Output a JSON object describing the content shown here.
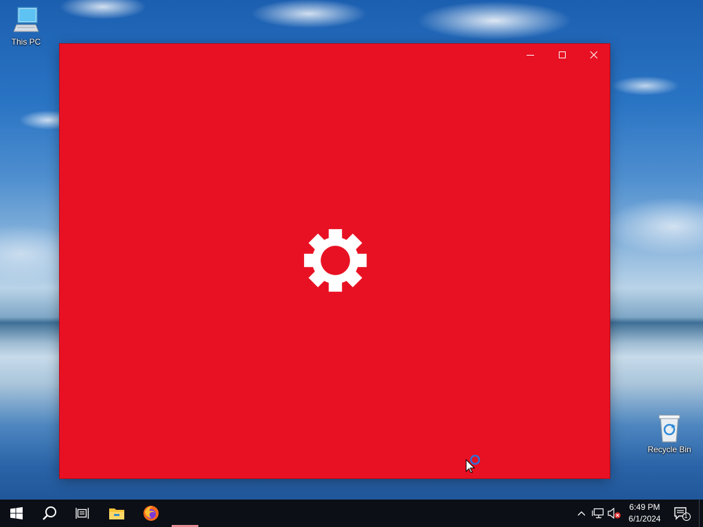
{
  "desktop": {
    "icons": [
      {
        "label": "This PC",
        "icon": "this-pc-icon"
      },
      {
        "label": "Recycle Bin",
        "icon": "recycle-bin-icon"
      }
    ]
  },
  "window": {
    "background_color": "#e81123",
    "content_icon": "gear-icon",
    "caption_buttons": [
      "minimize",
      "maximize",
      "close"
    ]
  },
  "taskbar": {
    "background_color": "#0c0f16",
    "buttons": [
      "start-icon",
      "search-icon",
      "task-view-icon",
      "file-explorer-icon",
      "firefox-icon"
    ],
    "tray": {
      "icons": [
        "chevron-up-icon",
        "network-icon",
        "volume-muted-icon"
      ],
      "time": "6:49 PM",
      "date": "6/1/2024",
      "notification_count": "1"
    }
  }
}
